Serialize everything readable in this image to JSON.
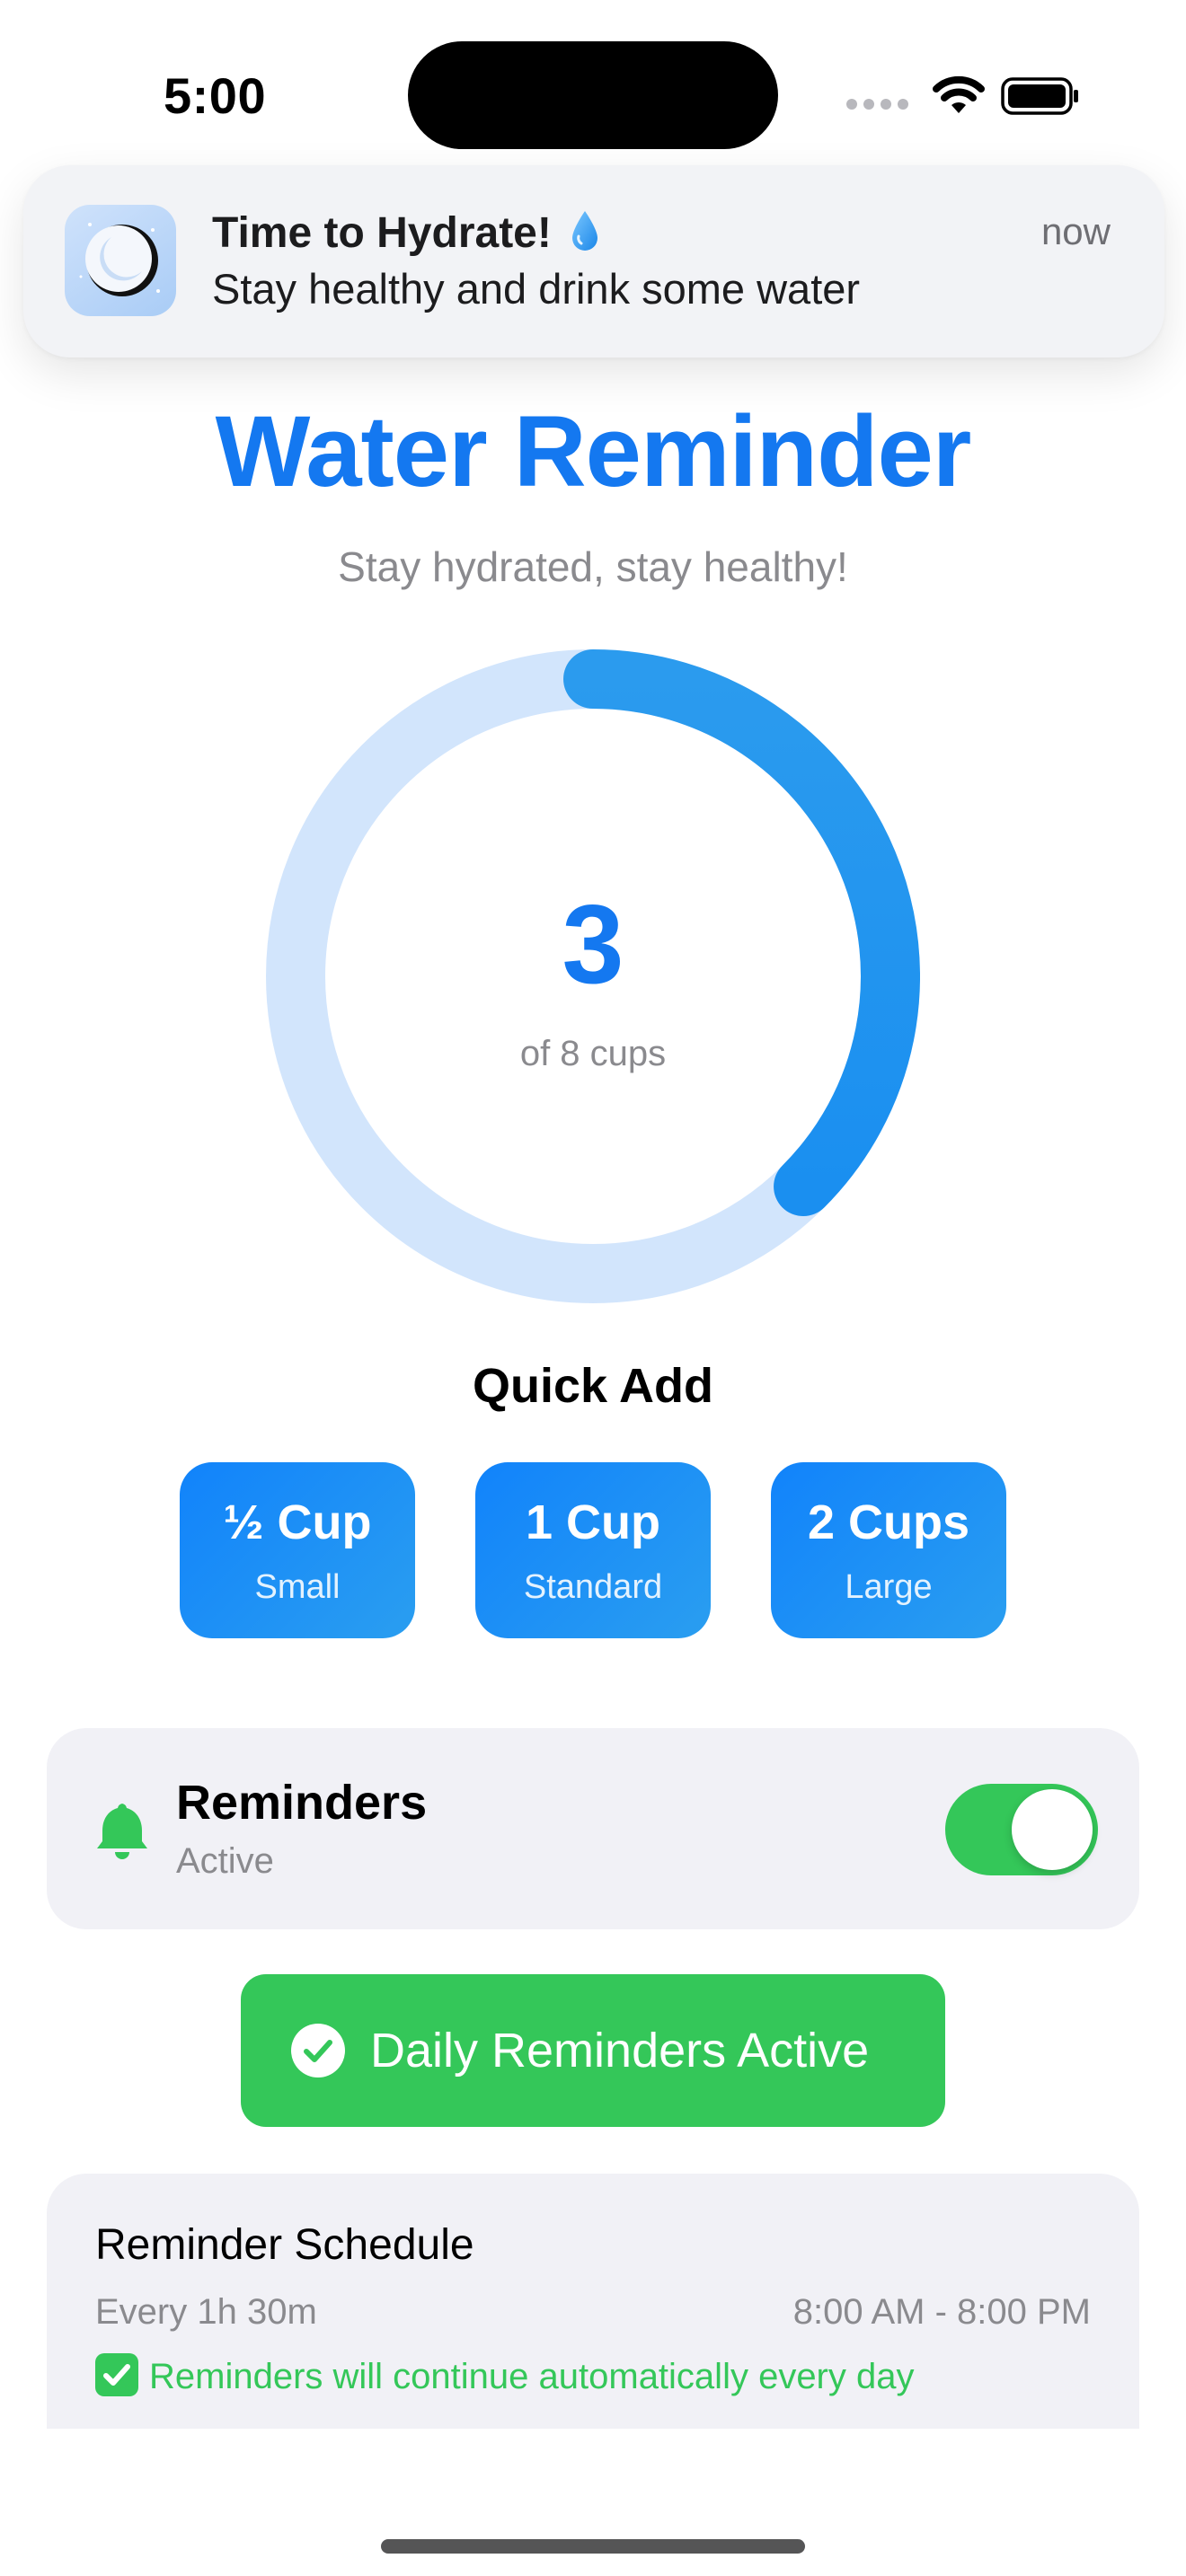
{
  "status_bar": {
    "time": "5:00",
    "icons": [
      "signal-dots-icon",
      "wifi-icon",
      "battery-icon"
    ]
  },
  "notification": {
    "icon": "moon-app-icon",
    "title": "Time to Hydrate!",
    "title_emoji": "water-drop-icon",
    "body": "Stay healthy and drink some water",
    "time": "now"
  },
  "header": {
    "title": "Water Reminder",
    "subtitle": "Stay hydrated, stay healthy!"
  },
  "progress": {
    "count": "3",
    "label": "of 8 cups",
    "current": 3,
    "goal": 8,
    "track_color": "#d2e5fc",
    "fill_color": "#2a9ef0"
  },
  "quick_add": {
    "title": "Quick Add",
    "buttons": [
      {
        "label": "½ Cup",
        "sub": "Small"
      },
      {
        "label": "1 Cup",
        "sub": "Standard"
      },
      {
        "label": "2 Cups",
        "sub": "Large"
      }
    ]
  },
  "reminders": {
    "icon": "bell-icon",
    "title": "Reminders",
    "status": "Active",
    "enabled": true
  },
  "active_button": {
    "icon": "checkmark-circle-icon",
    "label": "Daily Reminders Active"
  },
  "schedule": {
    "title": "Reminder Schedule",
    "interval": "Every 1h 30m",
    "hours": "8:00 AM - 8:00 PM",
    "note": "Reminders will continue automatically every day",
    "note_icon": "check-mark-button-icon"
  },
  "colors": {
    "accent": "#1478f0",
    "success": "#34c759",
    "card": "#f1f1f6"
  }
}
